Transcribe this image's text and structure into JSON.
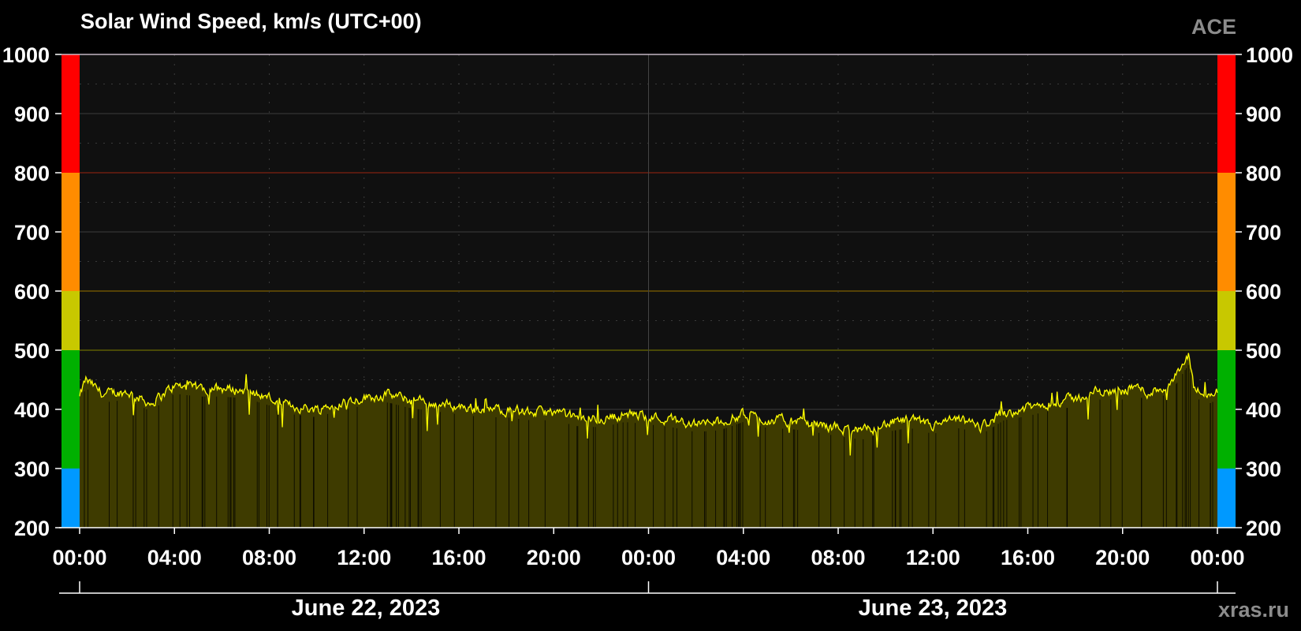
{
  "chart_data": {
    "type": "area",
    "title": "Solar Wind Speed, km/s (UTC+00)",
    "source": "ACE",
    "watermark": "xras.ru",
    "x_start": "2023-06-22 00:00",
    "x_end": "2023-06-24 00:00",
    "ylim": [
      200,
      1000
    ],
    "y_ticks": [
      "1000",
      "900",
      "800",
      "700",
      "600",
      "500",
      "400",
      "300",
      "200"
    ],
    "x_tick_labels": [
      "00:00",
      "04:00",
      "08:00",
      "12:00",
      "16:00",
      "20:00",
      "00:00",
      "04:00",
      "08:00",
      "12:00",
      "16:00",
      "20:00",
      "00:00"
    ],
    "date_labels": [
      "June 22, 2023",
      "June 23, 2023"
    ],
    "grid": true,
    "threshold_bands": [
      {
        "from": 200,
        "to": 300,
        "color": "#0099ff"
      },
      {
        "from": 300,
        "to": 500,
        "color": "#00b000"
      },
      {
        "from": 500,
        "to": 600,
        "color": "#c8c800"
      },
      {
        "from": 600,
        "to": 800,
        "color": "#ff8c00"
      },
      {
        "from": 800,
        "to": 1000,
        "color": "#ff0000"
      }
    ],
    "threshold_lines": [
      {
        "value": 500,
        "color": "#6b6b00"
      },
      {
        "value": 600,
        "color": "#806000"
      },
      {
        "value": 800,
        "color": "#802010"
      }
    ],
    "series": [
      {
        "color": "#ffff00",
        "fill": "#3e3b00",
        "x_hours": [
          0,
          0.25,
          1,
          2,
          3,
          4,
          5,
          6,
          7,
          8,
          8.5,
          9,
          10,
          11,
          12,
          13,
          14,
          15,
          16,
          17,
          18,
          19,
          20,
          21,
          22,
          23,
          24,
          25,
          26,
          27,
          28,
          29,
          30,
          31,
          32,
          33,
          34,
          35,
          36,
          37,
          37.5,
          38,
          39,
          40,
          41,
          42,
          43,
          44,
          44.5,
          45,
          46,
          46.8,
          47,
          47.5,
          48
        ],
        "values": [
          420,
          450,
          425,
          430,
          410,
          440,
          435,
          435,
          432,
          420,
          408,
          405,
          400,
          412,
          420,
          425,
          415,
          410,
          405,
          400,
          400,
          395,
          395,
          385,
          383,
          392,
          388,
          383,
          375,
          378,
          392,
          382,
          380,
          375,
          368,
          362,
          375,
          382,
          372,
          382,
          378,
          370,
          395,
          402,
          412,
          418,
          430,
          430,
          440,
          428,
          440,
          490,
          438,
          420,
          430
        ]
      }
    ]
  }
}
